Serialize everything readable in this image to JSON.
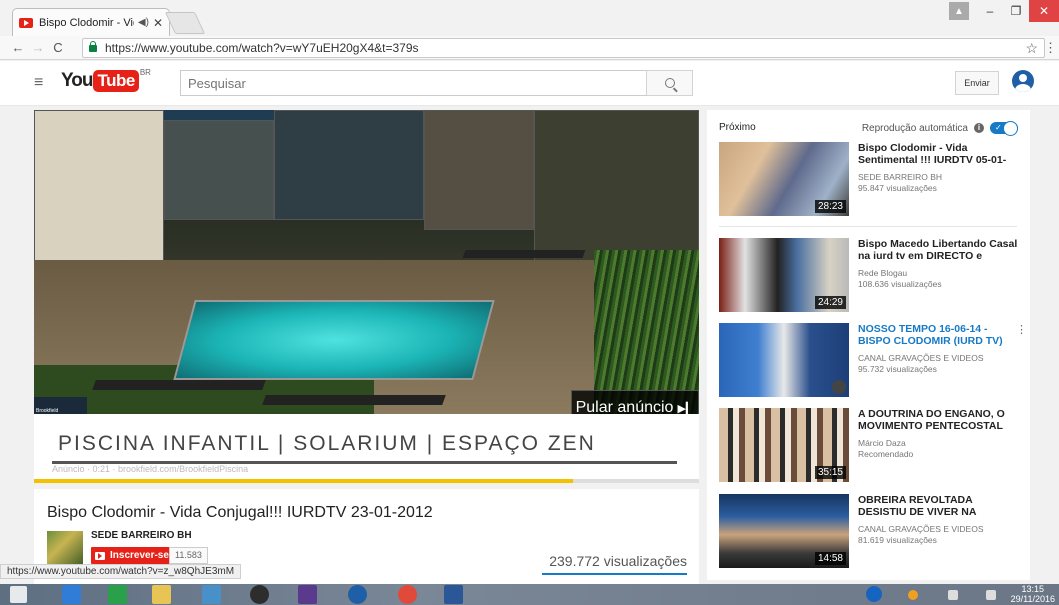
{
  "browser": {
    "tab_title": "Bispo Clodomir - Vida",
    "url": "https://www.youtube.com/watch?v=wY7uEH20gX4&t=379s"
  },
  "youtube": {
    "region": "BR",
    "search_placeholder": "Pesquisar",
    "upload_label": "Enviar"
  },
  "ad": {
    "title": "PISCINA INFANTIL | SOLARIUM | ESPAÇO ZEN",
    "sub": "Anúncio · 0:21 · brookfield.com/BrookfieldPiscina",
    "skip_label": "Pular anúncio",
    "brand": "Brookfield",
    "progress": 0.81
  },
  "video": {
    "title": "Bispo Clodomir - Vida Conjugal!!! IURDTV 23-01-2012",
    "channel": "SEDE BARREIRO BH",
    "subscribe_label": "Inscrever-se",
    "subscribers": "11.583",
    "views": "239.772 visualizações"
  },
  "status_url": "https://www.youtube.com/watch?v=z_w8QhJE3mM",
  "sidebar": {
    "next_label": "Próximo",
    "autoplay_label": "Reprodução automática",
    "items": [
      {
        "title": "Bispo Clodomir - Vida Sentimental !!! IURDTV 05-01-",
        "channel": "SEDE BARREIRO BH",
        "views": "95.847 visualizações",
        "duration": "28:23"
      },
      {
        "title": "Bispo Macedo Libertando Casal na iurd tv em DIRECTO e",
        "channel": "Rede Blogau",
        "views": "108.636 visualizações",
        "duration": "24:29"
      },
      {
        "title": "NOSSO TEMPO 16-06-14 - BISPO CLODOMIR (IURD TV)",
        "channel": "CANAL GRAVAÇÕES E VIDEOS",
        "views": "95.732 visualizações",
        "duration": ""
      },
      {
        "title": "A DOUTRINA DO ENGANO, O MOVIMENTO PENTECOSTAL",
        "channel": "Márcio Daza",
        "views": "Recomendado",
        "duration": "35:15"
      },
      {
        "title": "OBREIRA REVOLTADA DESISTIU DE VIVER NA",
        "channel": "CANAL GRAVAÇÕES E VIDEOS",
        "views": "81.619 visualizações",
        "duration": "14:58"
      }
    ]
  },
  "taskbar": {
    "time": "13:15",
    "date": "29/11/2016"
  }
}
